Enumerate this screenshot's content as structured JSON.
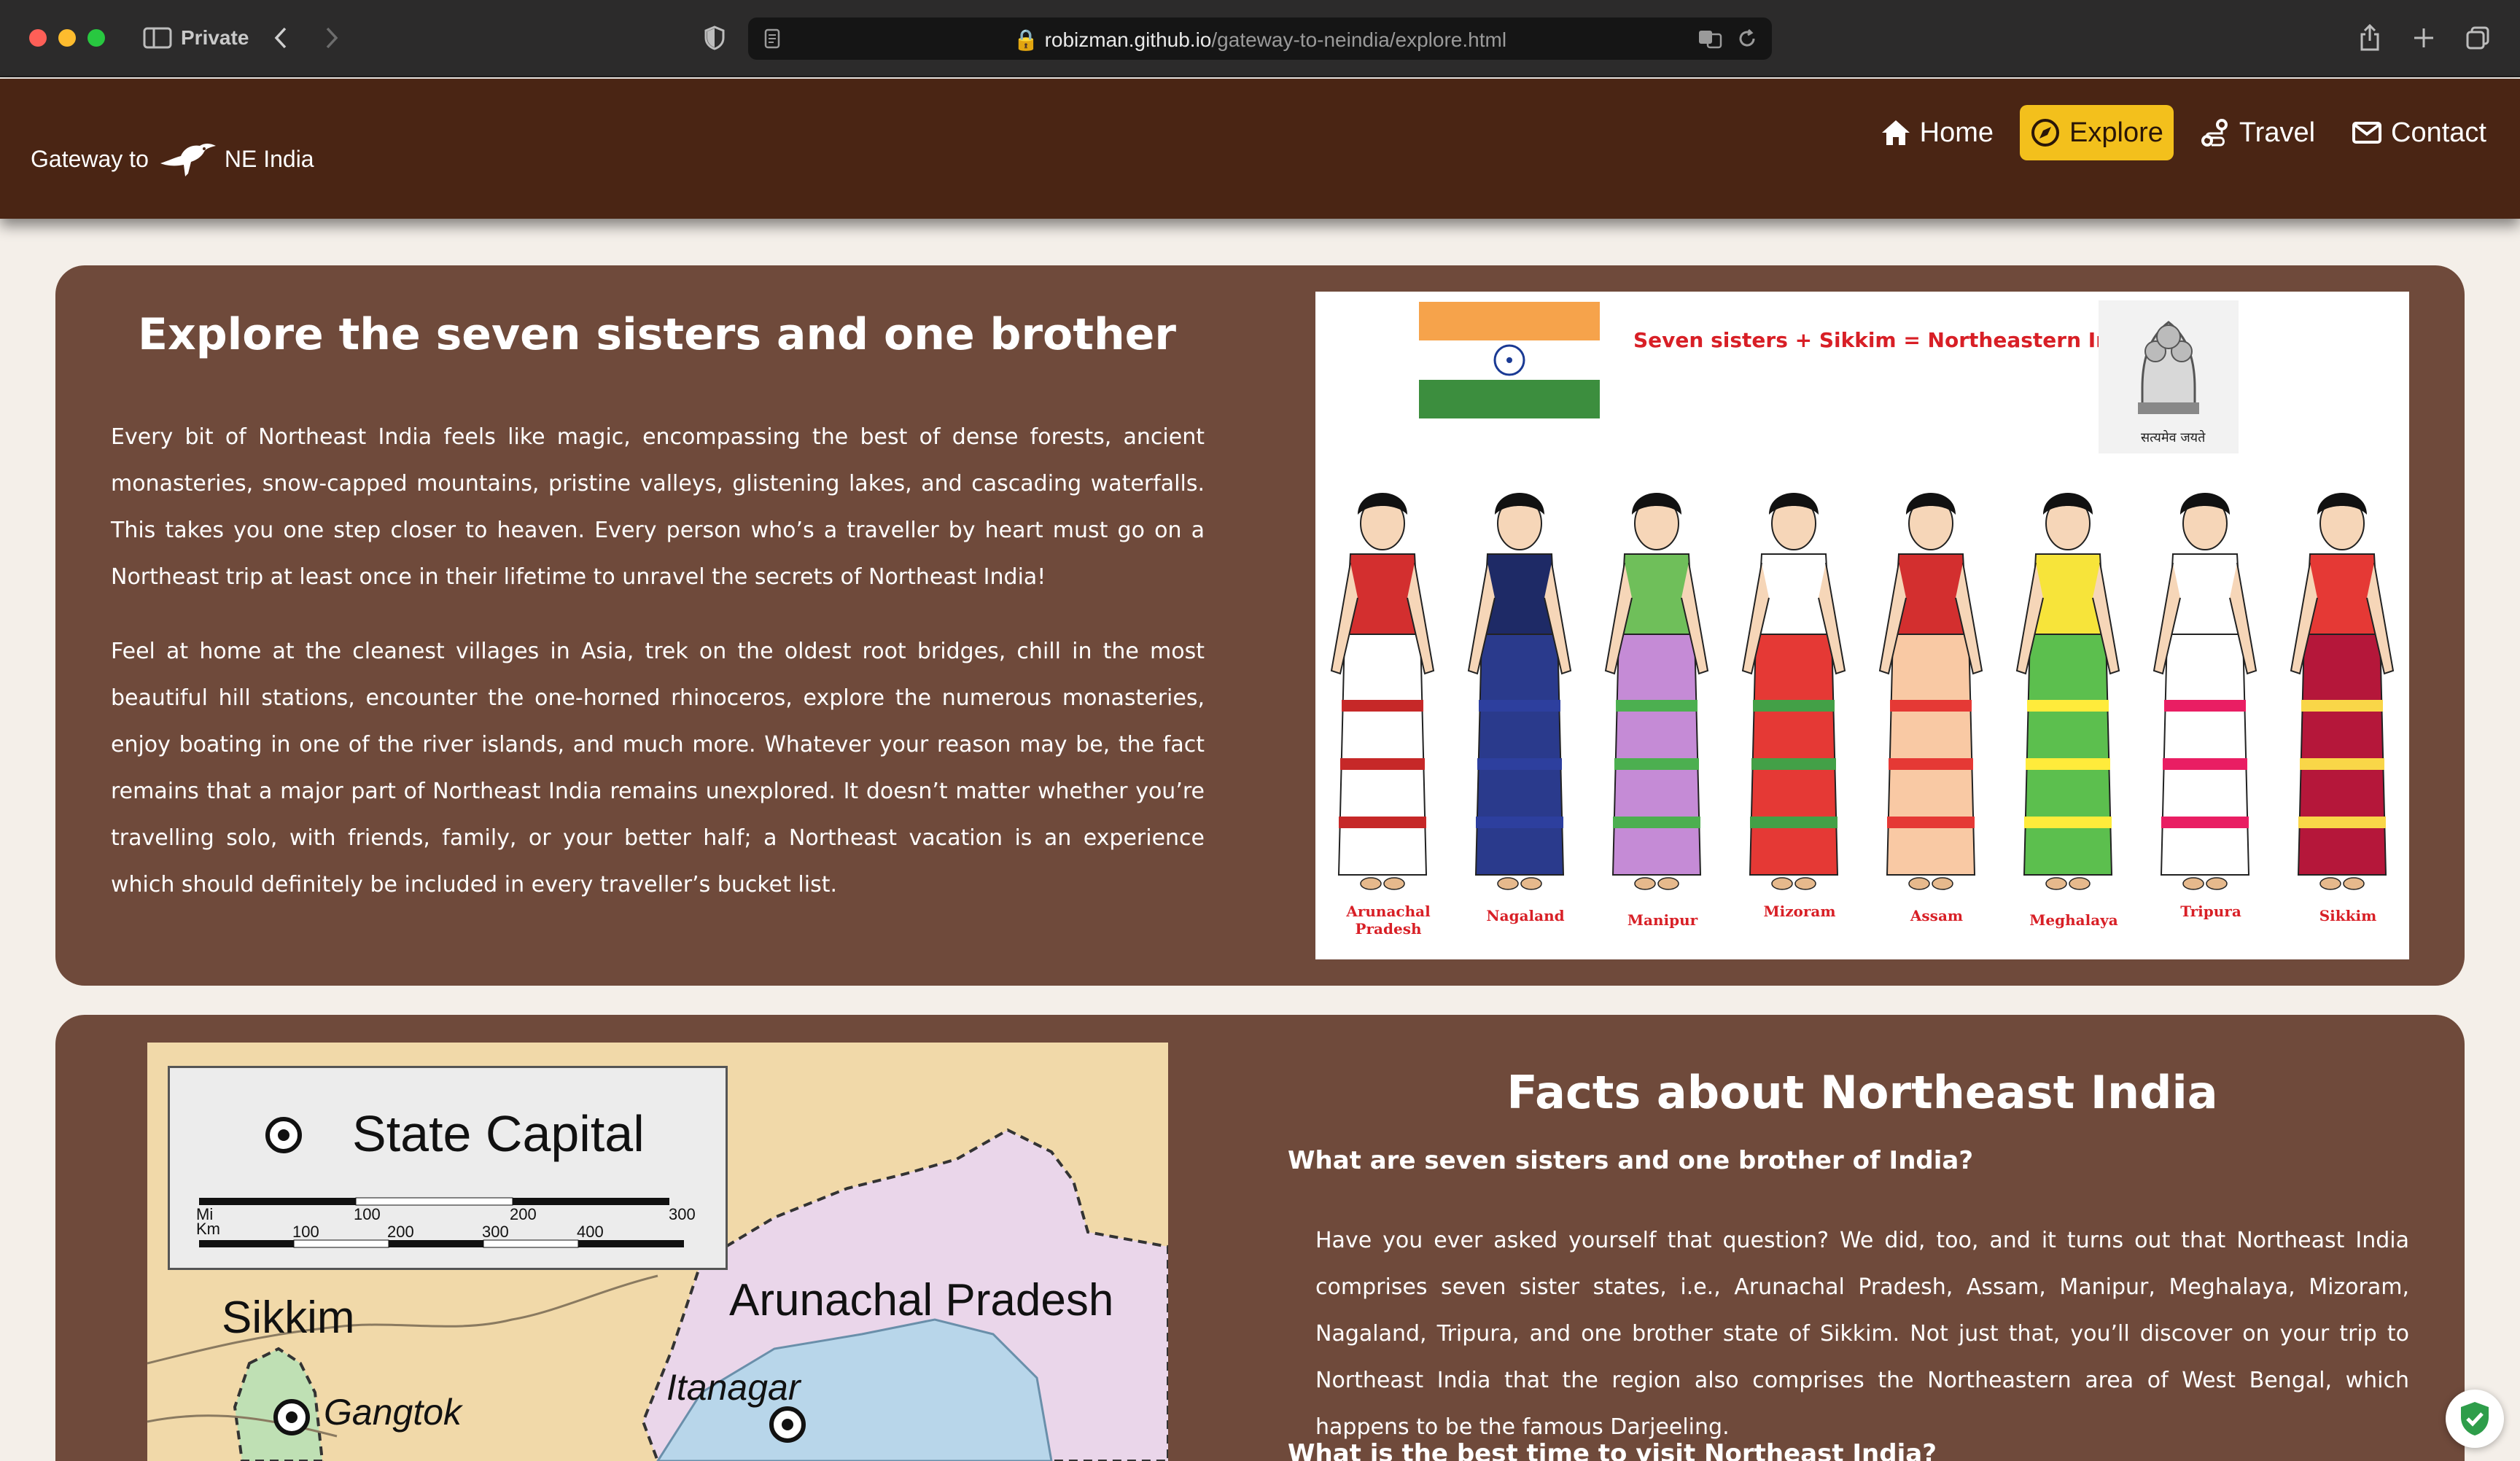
{
  "browser": {
    "private_label": "Private",
    "url_host": "robizman.github.io",
    "url_path": "/gateway-to-neindia/explore.html"
  },
  "site": {
    "brand_prefix": "Gateway to",
    "brand_suffix": "NE India",
    "nav": [
      {
        "label": "Home",
        "icon": "home-icon",
        "active": false
      },
      {
        "label": "Explore",
        "icon": "compass-icon",
        "active": true
      },
      {
        "label": "Travel",
        "icon": "route-icon",
        "active": false
      },
      {
        "label": "Contact",
        "icon": "envelope-icon",
        "active": false
      }
    ]
  },
  "explore": {
    "title": "Explore the seven sisters and one brother",
    "paragraph_1": "Every bit of Northeast India feels like magic, encompassing the best of dense forests, ancient monasteries, snow-capped mountains, pristine valleys, glistening lakes, and cascading waterfalls. This takes you one step closer to heaven. Every person who’s a traveller by heart must go on a Northeast trip at least once in their lifetime to unravel the secrets of Northeast India!",
    "paragraph_2": "Feel at home at the cleanest villages in Asia, trek on the oldest root bridges, chill in the most beautiful hill stations, encounter the one-horned rhinoceros, explore the numerous monasteries, enjoy boating in one of the river islands, and much more. Whatever your reason may be, the fact remains that a major part of Northeast India remains unexplored. It doesn’t matter whether you’re travelling solo, with friends, family, or your better half; a Northeast vacation is an experience which should definitely be included in every traveller’s bucket list.",
    "illustration": {
      "caption": "Seven sisters + Sikkim = Northeastern India",
      "emblem_motto": "सत्यमेव जयते",
      "states": [
        {
          "label": "Arunachal Pradesh",
          "dress": "#ffffff",
          "accent": "#c62828",
          "top": "#d32f2f"
        },
        {
          "label": "Nagaland",
          "dress": "#2a3a8c",
          "accent": "#2d3f9e",
          "top": "#1e2a66"
        },
        {
          "label": "Manipur",
          "dress": "#c58bd6",
          "accent": "#4caf50",
          "top": "#6fbf5a"
        },
        {
          "label": "Mizoram",
          "dress": "#e53935",
          "accent": "#43a047",
          "top": "#ffffff"
        },
        {
          "label": "Assam",
          "dress": "#f9c9a4",
          "accent": "#e53935",
          "top": "#d32f2f"
        },
        {
          "label": "Meghalaya",
          "dress": "#5cbf4e",
          "accent": "#ffeb3b",
          "top": "#f7e43a"
        },
        {
          "label": "Tripura",
          "dress": "#ffffff",
          "accent": "#e91e63",
          "top": "#ffffff"
        },
        {
          "label": "Sikkim",
          "dress": "#b5173a",
          "accent": "#f9d648",
          "top": "#e53935"
        }
      ]
    }
  },
  "facts": {
    "title": "Facts about Northeast India",
    "question_1": "What are seven sisters and one brother of India?",
    "answer_1": "Have you ever asked yourself that question? We did, too, and it turns out that Northeast India comprises seven sister states, i.e., Arunachal Pradesh, Assam, Manipur, Meghalaya, Mizoram, Nagaland, Tripura, and one brother state of Sikkim. Not just that, you’ll discover on your trip to Northeast India that the region also comprises the Northeastern area of West Bengal, which happens to be the famous Darjeeling.",
    "question_2": "What is the best time to visit Northeast India?"
  },
  "map": {
    "legend_title": "State Capital",
    "scale_mi_label": "Mi",
    "scale_km_label": "Km",
    "scale_mi_ticks": [
      "100",
      "200",
      "300"
    ],
    "scale_km_ticks": [
      "100",
      "200",
      "300",
      "400"
    ],
    "labels": {
      "sikkim": "Sikkim",
      "gangtok": "Gangtok",
      "arunachal": "Arunachal Pradesh",
      "itanagar": "Itanagar"
    }
  }
}
